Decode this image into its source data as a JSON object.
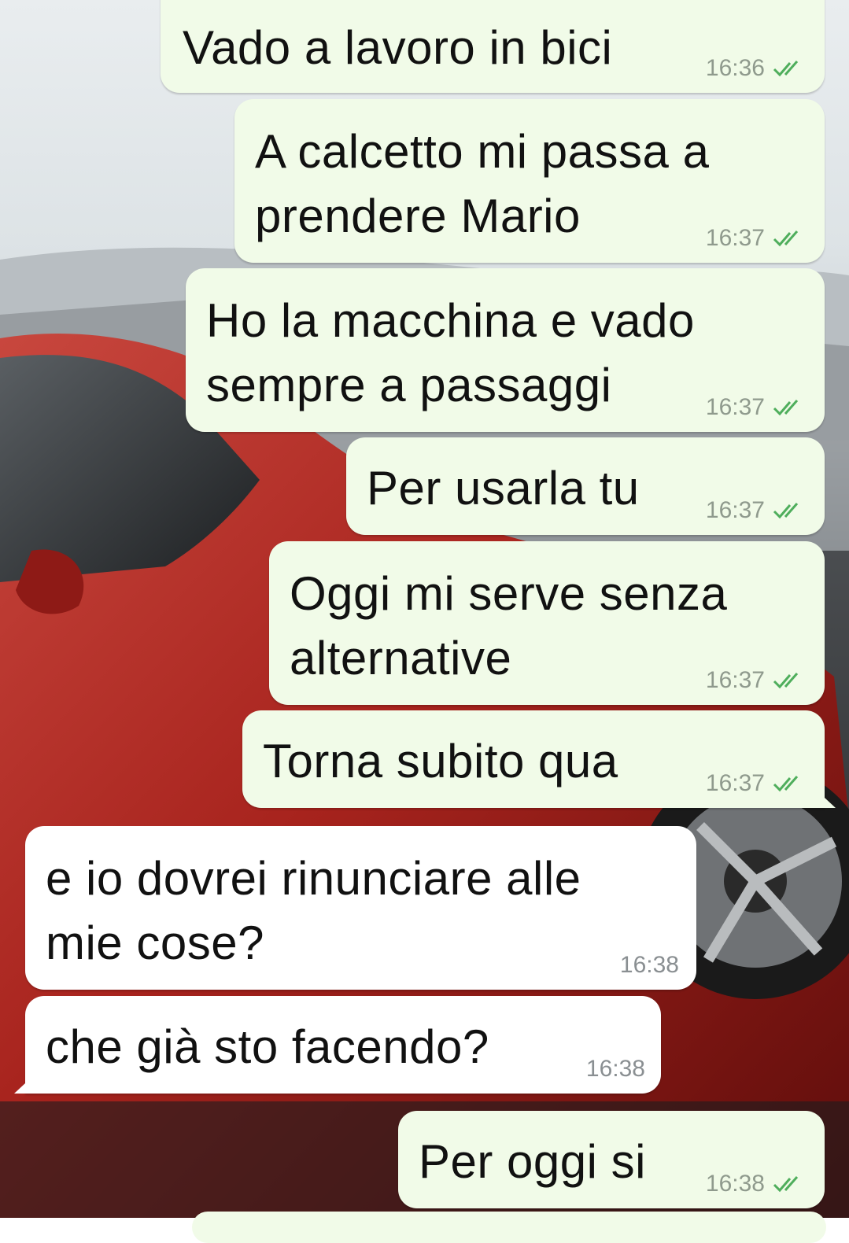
{
  "chat": {
    "messages": [
      {
        "direction": "out",
        "lines": [
          "Vado a lavoro in bici"
        ],
        "time": "16:36",
        "status": "read"
      },
      {
        "direction": "out",
        "lines": [
          "A calcetto mi passa a",
          "prendere Mario"
        ],
        "time": "16:37",
        "status": "read"
      },
      {
        "direction": "out",
        "lines": [
          "Ho la macchina e vado",
          "sempre a passaggi"
        ],
        "time": "16:37",
        "status": "read"
      },
      {
        "direction": "out",
        "lines": [
          "Per usarla tu"
        ],
        "time": "16:37",
        "status": "read"
      },
      {
        "direction": "out",
        "lines": [
          "Oggi mi serve senza",
          "alternative"
        ],
        "time": "16:37",
        "status": "read"
      },
      {
        "direction": "out",
        "lines": [
          "Torna subito qua"
        ],
        "time": "16:37",
        "status": "read"
      },
      {
        "direction": "in",
        "lines": [
          "e io dovrei rinunciare alle",
          "mie cose?"
        ],
        "time": "16:38"
      },
      {
        "direction": "in",
        "lines": [
          "che già sto facendo?"
        ],
        "time": "16:38"
      },
      {
        "direction": "out",
        "lines": [
          "Per oggi si"
        ],
        "time": "16:38",
        "status": "read"
      }
    ]
  },
  "colors": {
    "outgoing_bubble": "#f1fbe8",
    "incoming_bubble": "#ffffff",
    "read_tick": "#4fae5c",
    "timestamp": "#8f9a8d"
  },
  "icons": {
    "read_status": "double-check-icon"
  }
}
